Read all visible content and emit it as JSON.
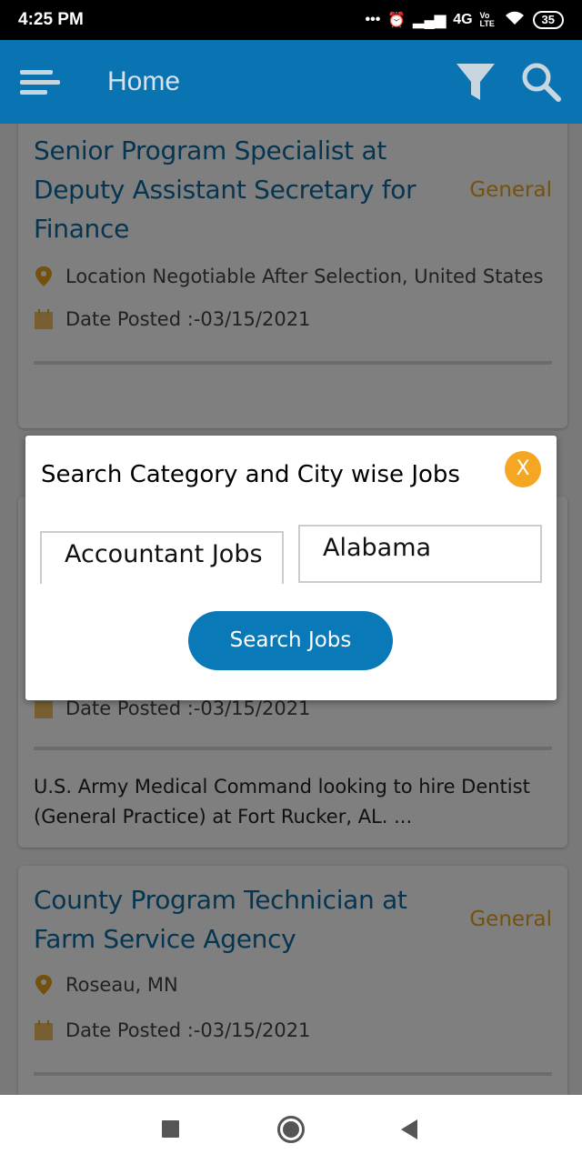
{
  "status_bar": {
    "time": "4:25 PM",
    "network": "4G",
    "volte": "Vo LTE",
    "battery": "35"
  },
  "app_bar": {
    "title": "Home",
    "menu_icon": "hamburger-menu-icon",
    "filter_icon": "filter-icon",
    "search_icon": "search-icon"
  },
  "jobs": [
    {
      "title": "Senior Program Specialist at Deputy Assistant Secretary for Finance",
      "category": "General",
      "location": "Location Negotiable After Selection, United States",
      "date_posted": "Date Posted :-03/15/2021"
    },
    {
      "title": "",
      "category": "",
      "location": "",
      "date_posted": "Date Posted :-03/15/2021",
      "description": "U.S. Army Medical Command looking to hire Dentist (General Practice) at Fort Rucker, AL. ..."
    },
    {
      "title": "County Program Technician at Farm Service Agency",
      "category": "General",
      "location": "Roseau, MN",
      "date_posted": "Date Posted :-03/15/2021"
    }
  ],
  "modal": {
    "title": "Search Category and City wise Jobs",
    "close_label": "X",
    "category_value": "Accountant Jobs",
    "city_value": "Alabama",
    "search_button": "Search Jobs"
  },
  "colors": {
    "app_bar": "#0a74b3",
    "title_text": "#0a6aa0",
    "accent": "#e9a21b",
    "close_button": "#f5a623",
    "search_button": "#0a79b8"
  }
}
